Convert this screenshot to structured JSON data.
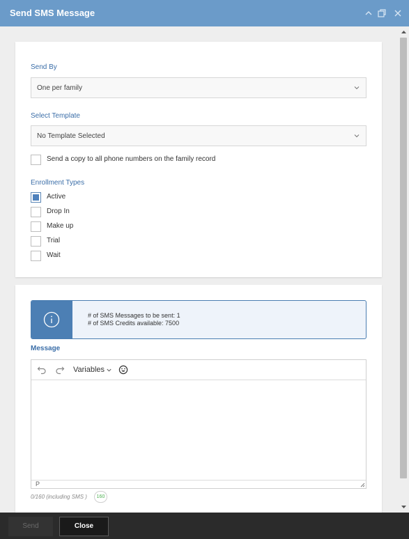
{
  "window": {
    "title": "Send SMS Message"
  },
  "form": {
    "send_by": {
      "label": "Send By",
      "value": "One per family"
    },
    "template": {
      "label": "Select Template",
      "value": "No Template Selected"
    },
    "copy_all": {
      "label": "Send a copy to all phone numbers on the family record",
      "checked": false
    },
    "enrollment": {
      "label": "Enrollment Types",
      "items": [
        {
          "label": "Active",
          "checked": true
        },
        {
          "label": "Drop In",
          "checked": false
        },
        {
          "label": "Make up",
          "checked": false
        },
        {
          "label": "Trial",
          "checked": false
        },
        {
          "label": "Wait",
          "checked": false
        }
      ]
    }
  },
  "info": {
    "icon": "info-icon",
    "line1": "# of SMS Messages to be sent: 1",
    "line2": "# of SMS Credits available: 7500"
  },
  "message": {
    "label": "Message",
    "variables_label": "Variables",
    "path_indicator": "P",
    "counter": "0/160 (including SMS )",
    "badge": "160"
  },
  "footer": {
    "send_label": "Send",
    "close_label": "Close"
  },
  "colors": {
    "titlebar": "#6b9bc9",
    "accent": "#4c7fb4",
    "label": "#3b6ea8",
    "footer": "#2b2b2b"
  }
}
